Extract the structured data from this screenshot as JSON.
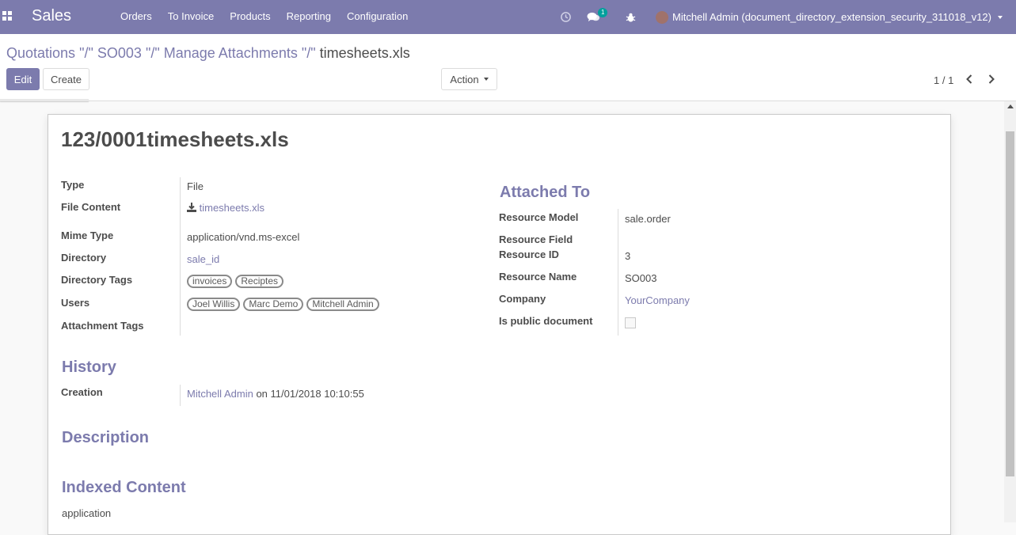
{
  "navbar": {
    "app_name": "Sales",
    "menu": [
      "Orders",
      "To Invoice",
      "Products",
      "Reporting",
      "Configuration"
    ],
    "messages_badge": "1",
    "user_label": "Mitchell Admin (document_directory_extension_security_311018_v12)",
    "bg_color": "#7c7bad",
    "icons": [
      "apps-icon",
      "clock-icon",
      "chat-icon",
      "bug-icon",
      "avatar",
      "caret-icon"
    ]
  },
  "breadcrumb": {
    "parts": [
      "Quotations",
      "\"/\"",
      "SO003",
      "\"/\"",
      "Manage Attachments",
      "\"/\""
    ],
    "current": "timesheets.xls"
  },
  "buttons": {
    "edit": "Edit",
    "create": "Create",
    "action": "Action"
  },
  "pager": {
    "value": "1 / 1"
  },
  "record": {
    "title": "123/0001timesheets.xls",
    "left_fields": {
      "type_label": "Type",
      "type_value": "File",
      "file_content_label": "File Content",
      "file_content_value": "timesheets.xls",
      "mime_label": "Mime Type",
      "mime_value": "application/vnd.ms-excel",
      "directory_label": "Directory",
      "directory_value": "sale_id",
      "dir_tags_label": "Directory Tags",
      "dir_tags": [
        "invoices",
        "Reciptes"
      ],
      "users_label": "Users",
      "users": [
        "Joel Willis",
        "Marc Demo",
        "Mitchell Admin"
      ],
      "att_tags_label": "Attachment Tags"
    },
    "attached_to": {
      "heading": "Attached To",
      "res_model_label": "Resource Model",
      "res_model_value": "sale.order",
      "res_field_label": "Resource Field",
      "res_id_label": "Resource ID",
      "res_id_value": "3",
      "res_name_label": "Resource Name",
      "res_name_value": "SO003",
      "company_label": "Company",
      "company_value": "YourCompany",
      "public_label": "Is public document",
      "public_value": false
    },
    "history": {
      "heading": "History",
      "creation_label": "Creation",
      "creation_user": "Mitchell Admin",
      "creation_on": "on 11/01/2018 10:10:55"
    },
    "description_heading": "Description",
    "indexed": {
      "heading": "Indexed Content",
      "value": "application"
    }
  }
}
